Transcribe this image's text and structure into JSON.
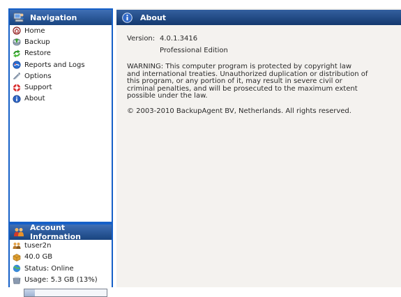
{
  "navigation": {
    "title": "Navigation",
    "icon": "user-computer-icon",
    "items": [
      {
        "label": "Home",
        "icon": "home-icon"
      },
      {
        "label": "Backup",
        "icon": "backup-icon"
      },
      {
        "label": "Restore",
        "icon": "restore-icon"
      },
      {
        "label": "Reports and Logs",
        "icon": "reports-icon"
      },
      {
        "label": "Options",
        "icon": "options-icon"
      },
      {
        "label": "Support",
        "icon": "support-icon"
      },
      {
        "label": "About",
        "icon": "info-icon"
      }
    ]
  },
  "account": {
    "title": "Account Information",
    "icon": "users-icon",
    "username": "tuser2n",
    "quota": "40.0 GB",
    "status": "Status: Online",
    "usage": "Usage: 5.3 GB (13%)",
    "usage_fraction": 0.13
  },
  "about": {
    "title": "About",
    "version_label": "Version:",
    "version": "4.0.1.3416",
    "edition": "Professional Edition",
    "warning_lines": [
      "WARNING: This computer program is protected by copyright law",
      "and international treaties. Unauthorized duplication or distribution of",
      "this program, or any portion of it, may result in severe civil or",
      "criminal penalties, and will be prosecuted to the maximum extent",
      "possible under the law."
    ],
    "copyright": "© 2003-2010 BackupAgent BV, Netherlands. All rights reserved."
  },
  "colors": {
    "sidebar_border": "#1560c8",
    "header_dark": "#13386e",
    "header_light": "#3f6fb5",
    "main_bg": "#f4f2ef"
  }
}
